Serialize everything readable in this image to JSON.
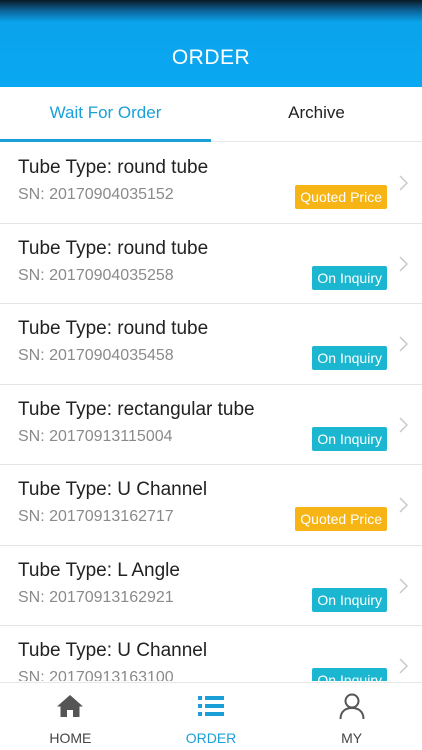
{
  "header": {
    "title": "ORDER"
  },
  "tabs": [
    {
      "label": "Wait For Order",
      "active": true
    },
    {
      "label": "Archive",
      "active": false
    }
  ],
  "status_colors": {
    "Quoted Price": "#f7b515",
    "On Inquiry": "#1bb6cf"
  },
  "orders": [
    {
      "title": "Tube Type: round tube",
      "sn": "SN: 20170904035152",
      "status": "Quoted Price"
    },
    {
      "title": "Tube Type: round tube",
      "sn": "SN: 20170904035258",
      "status": "On Inquiry"
    },
    {
      "title": "Tube Type: round tube",
      "sn": "SN: 20170904035458",
      "status": "On Inquiry"
    },
    {
      "title": "Tube Type: rectangular tube",
      "sn": "SN: 20170913115004",
      "status": "On Inquiry"
    },
    {
      "title": "Tube Type: U Channel",
      "sn": "SN: 20170913162717",
      "status": "Quoted Price"
    },
    {
      "title": "Tube Type: L Angle",
      "sn": "SN: 20170913162921",
      "status": "On Inquiry"
    },
    {
      "title": "Tube Type: U Channel",
      "sn": "SN: 20170913163100",
      "status": "On Inquiry"
    }
  ],
  "bottom_nav": [
    {
      "label": "HOME",
      "icon": "home-icon",
      "active": false
    },
    {
      "label": "ORDER",
      "icon": "list-icon",
      "active": true
    },
    {
      "label": "MY",
      "icon": "user-icon",
      "active": false
    }
  ],
  "accent_color": "#1a9fd9"
}
